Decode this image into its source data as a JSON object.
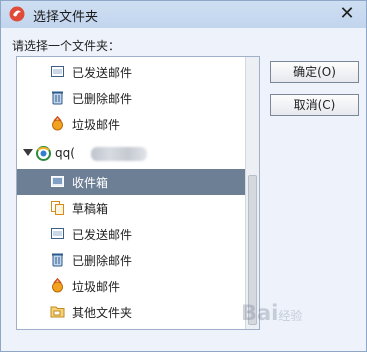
{
  "window": {
    "title": "选择文件夹"
  },
  "prompt": "请选择一个文件夹：",
  "tree": {
    "top_items": [
      {
        "label": "已发送邮件",
        "icon": "sent-mail-icon"
      },
      {
        "label": "已删除邮件",
        "icon": "trash-icon"
      },
      {
        "label": "垃圾邮件",
        "icon": "spam-icon"
      }
    ],
    "account": {
      "label": "qq(",
      "icon": "account-icon"
    },
    "account_items": [
      {
        "label": "收件箱",
        "icon": "inbox-icon",
        "selected": true
      },
      {
        "label": "草稿箱",
        "icon": "drafts-icon"
      },
      {
        "label": "已发送邮件",
        "icon": "sent-mail-icon"
      },
      {
        "label": "已删除邮件",
        "icon": "trash-icon"
      },
      {
        "label": "垃圾邮件",
        "icon": "spam-icon"
      },
      {
        "label": "其他文件夹",
        "icon": "folder-icon"
      }
    ]
  },
  "buttons": {
    "ok": "确定(O)",
    "cancel": "取消(C)"
  },
  "watermark": {
    "main": "Bai",
    "sub": "经验"
  },
  "colors": {
    "selection": "#6d7f94",
    "title_bar": "#c8daf0"
  }
}
